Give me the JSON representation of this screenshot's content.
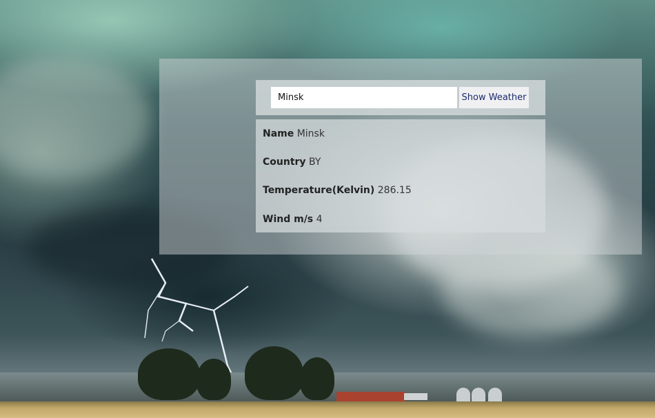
{
  "search": {
    "value": "Minsk",
    "button_label": "Show Weather"
  },
  "results": {
    "name_label": "Name",
    "name_value": "Minsk",
    "country_label": "Country",
    "country_value": "BY",
    "temperature_label": "Temperature(Kelvin)",
    "temperature_value": "286.15",
    "wind_label": "Wind m/s",
    "wind_value": "4"
  },
  "colors": {
    "button_text": "#1a2a6c",
    "panel_overlay": "#d2d6d8",
    "barn": "#a9432f"
  },
  "background_image": "storm-clouds-lightning-farm"
}
